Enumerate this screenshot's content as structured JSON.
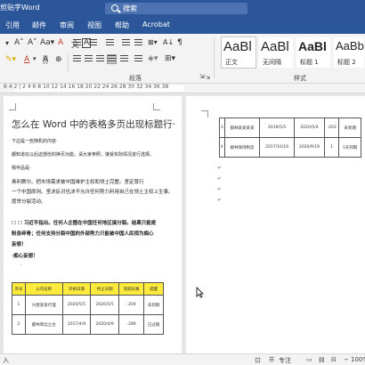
{
  "window": {
    "title": "剪贴字Word",
    "search_placeholder": "搜索"
  },
  "tabs": [
    "引用",
    "邮件",
    "审阅",
    "视图",
    "帮助",
    "Acrobat"
  ],
  "ribbon": {
    "paragraph_group_label": "段落",
    "styles_group_label": "样式",
    "styles": [
      {
        "sample": "AaBl",
        "name": "正文"
      },
      {
        "sample": "AaBl",
        "name": "无间隔"
      },
      {
        "sample": "AaBl",
        "name": "标题 1"
      },
      {
        "sample": "AaBbC",
        "name": "标题 2"
      }
    ]
  },
  "ruler": {
    "left_numbers": "6 4 2 | 2 4 6 8 10 12 14 16 18 20 22 24 26 28 30 32 34 36 38"
  },
  "document": {
    "heading": "怎么在 Word 中的表格多页出现标题行·",
    "paras": [
      "下边是一些随机的内容·",
      "都知道在以后这部份的换页功能，请大家参照，接受实际情况进行选择。",
      "我伴品是·",
      "奥利赛尔。把市场需求被中国维护主权和领土完整。坚定尊行",
      "一个中国原则。坚决反对也决不允许任何势力利用自己在领土主权上生事。",
      "度举分裂活动。",
      "☐ ☐ 习近平指出。任何人企图在中国任何地区搞分裂。结果只能是",
      "粉身碎骨；任何支持分裂中国的外部势力只能被中国人民视为痴心",
      "妄想！",
      "·痴心妄想！",
      "·"
    ],
    "table1": {
      "header": [
        "序号",
        "公司名称",
        "开始日期",
        "终止日期",
        "到期天数",
        "提醒"
      ],
      "rows": [
        [
          "1",
          "兴建某某代理",
          "2020/5/5",
          "2020/5/5",
          "-204",
          "未到期"
        ],
        [
          "2",
          "都林草北之也",
          "2017/4/9",
          "2020/4/9",
          "-289",
          "已过期"
        ]
      ]
    },
    "table2": {
      "rows": [
        [
          "3",
          "都林某某某某",
          "2019/5/5",
          "2020/5/4",
          "-203",
          "未到期"
        ],
        [
          "4",
          "都林保持制造",
          "2017/10/16",
          "2020/9/19",
          "1",
          "1天到期"
        ]
      ]
    },
    "page2_marks": [
      "↵",
      "↵",
      "↵",
      "↵"
    ]
  },
  "status": {
    "left": "入",
    "focus": "专注",
    "zoom": "100%"
  }
}
